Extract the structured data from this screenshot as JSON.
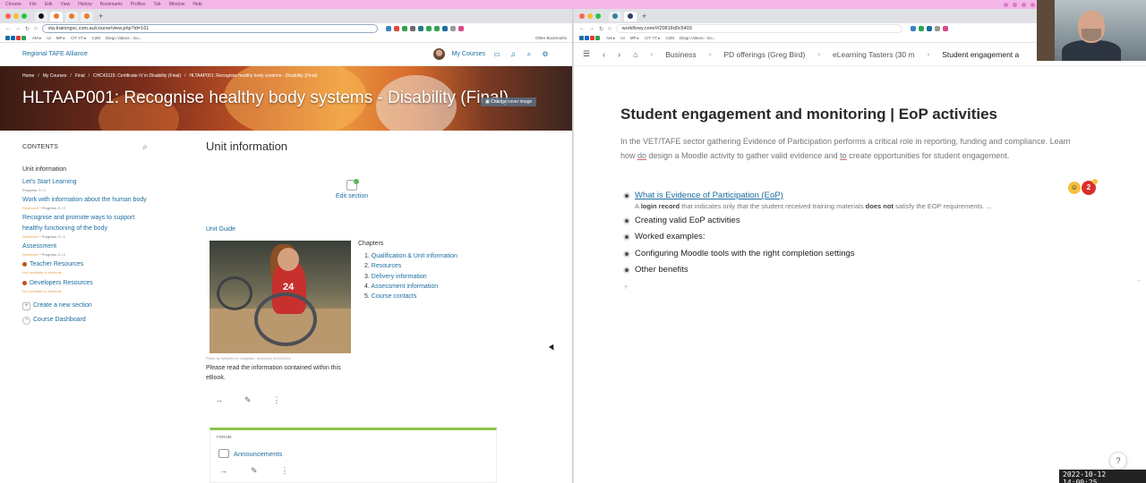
{
  "left_window": {
    "url": "vta.trainingvc.com.au/course/view.php?id=161",
    "bookmarks": [
      "AM ▸",
      "UI",
      "MP ▸",
      "CIT YT ▸",
      "C2M",
      "Diego Videos - Go..."
    ],
    "bookmarks_right": "Other Bookmarks",
    "site_name": "Regional TAFE Alliance",
    "my_courses": "My Courses",
    "breadcrumb": [
      "Home",
      "My Courses",
      "Final",
      "CHC43115: Certificate IV in Disability (Final)",
      "HLTAAP001: Recognise healthy body systems - Disability (Final)"
    ],
    "course_title": "HLTAAP001: Recognise healthy body systems - Disability (Final)",
    "change_cover": "Change cover image",
    "contents": {
      "heading": "CONTENTS",
      "items": [
        {
          "label": "Unit information",
          "progress": ""
        },
        {
          "label": "Let's Start Learning",
          "progress": "Progress: 0 / 1"
        },
        {
          "label": "Work with information about the human body",
          "progress_label": "Restricted",
          "progress": "Progress: 0 / 2"
        },
        {
          "label": "Recognise and promote ways to support healthy functioning of the body",
          "progress_label": "Restricted",
          "progress": "Progress: 0 / 1"
        },
        {
          "label": "Assessment",
          "progress_label": "Restricted",
          "progress": "Progress: 0 / 2"
        },
        {
          "label": "Teacher Resources",
          "note": "Not available to students"
        },
        {
          "label": "Developers Resources",
          "note": "Not available to students"
        }
      ],
      "create_section": "Create a new section",
      "course_dashboard": "Course Dashboard"
    },
    "main": {
      "heading": "Unit information",
      "edit_section": "Edit section",
      "unit_guide": "Unit Guide",
      "photo_number": "24",
      "photo_credit": "Photo by Wikedin on Unsplash, accessed 01/02/2021",
      "read_text": "Please read the information contained within this eBook.",
      "chapters_title": "Chapters",
      "chapters": [
        "Qualification & Unit information",
        "Resources",
        "Delivery information",
        "Assessment information",
        "Course contacts"
      ],
      "forum_label": "FORUM",
      "forum_title": "Announcements"
    }
  },
  "right_window": {
    "url": "workflowy.com/#/20818d9c5403",
    "breadcrumb": [
      "Business",
      "PD offerings (Greg Bird)",
      "eLearning Tasters (30 m",
      "Student engagement a"
    ],
    "title": "Student engagement and monitoring | EoP activities",
    "note_part1": "In the VET/TAFE sector gathering Evidence of Participation performs a critical role in reporting, funding and compliance.   Learn how ",
    "note_do": "do",
    "note_part2": " design a Moodle activity to gather valid evidence and ",
    "note_to": "to",
    "note_part3": " create opportunities for student engagement.",
    "bullets": [
      {
        "text": "What is Evidence of Participation (EoP)",
        "link": true
      },
      {
        "text": "Creating valid EoP activities"
      },
      {
        "text": "Worked examples:"
      },
      {
        "text": "Configuring Moodle tools with the right completion settings"
      },
      {
        "text": "Other benefits"
      }
    ],
    "bullet_note_a": "A ",
    "bullet_note_b": "login record",
    "bullet_note_c": " that indicates only that the student received training materials ",
    "bullet_note_d": "does not",
    "bullet_note_e": " satisfy the EOP requirements. ...",
    "badge_count": "2",
    "help": "?"
  },
  "timestamp": "2022-10-12 14:00:25",
  "colors": {
    "moodle_link": "#1b6ea0",
    "forum_accent": "#8bc34a",
    "menubar": "#f3b6e6"
  }
}
